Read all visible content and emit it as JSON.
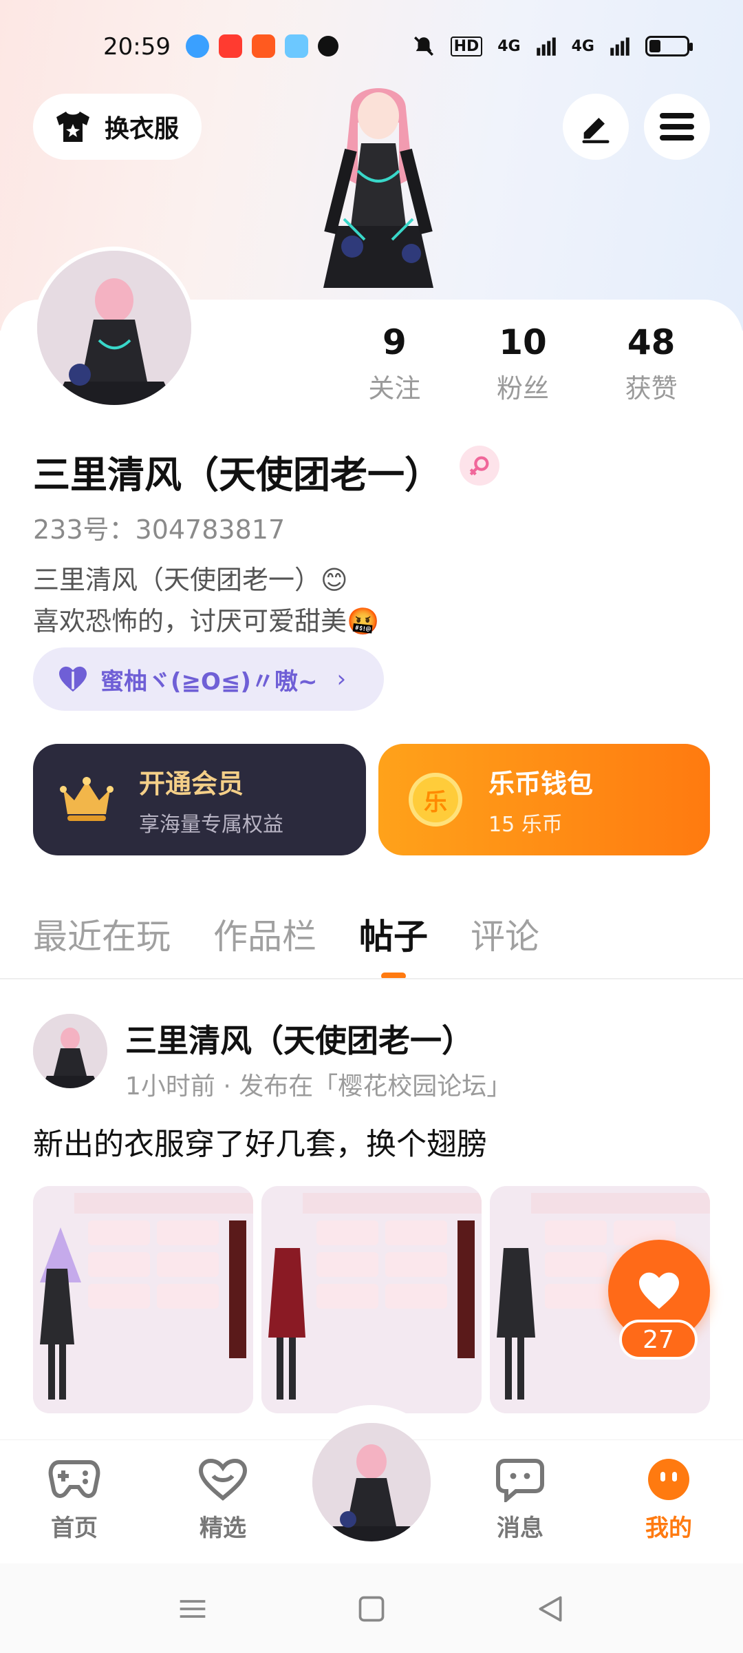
{
  "status_bar": {
    "time": "20:59",
    "hd_label": "HD",
    "signal1": "4G",
    "signal2": "4G",
    "battery_level": 0.3
  },
  "header": {
    "dress_label": "换衣服",
    "edit_icon": "edit-icon",
    "menu_icon": "menu-icon"
  },
  "profile": {
    "stats": [
      {
        "num": "9",
        "label": "关注"
      },
      {
        "num": "10",
        "label": "粉丝"
      },
      {
        "num": "48",
        "label": "获赞"
      }
    ],
    "nickname": "三里清风（天使团老一）",
    "uid": "233号：304783817",
    "bio_line1": "三里清风（天使团老一）😊",
    "bio_line2": "喜欢恐怖的，讨厌可爱甜美🤬",
    "honey_tag": "蜜柚ヾ(≧O≦)〃嗷~",
    "honey_arrow": "›"
  },
  "cards": {
    "vip_title": "开通会员",
    "vip_sub": "享海量专属权益",
    "wallet_title": "乐币钱包",
    "wallet_sub": "15 乐币",
    "coin_glyph": "乐"
  },
  "tabs": [
    {
      "label": "最近在玩"
    },
    {
      "label": "作品栏"
    },
    {
      "label": "帖子"
    },
    {
      "label": "评论"
    }
  ],
  "post": {
    "author": "三里清风（天使团老一）",
    "meta": "1小时前 · 发布在「樱花校园论坛」",
    "text": "新出的衣服穿了好几套，换个翅膀",
    "likes": "27"
  },
  "bottom_nav": [
    {
      "label": "首页"
    },
    {
      "label": "精选"
    },
    {
      "label": "消息"
    },
    {
      "label": "我的"
    }
  ],
  "colors": {
    "accent": "#ff7a10",
    "vip_bg": "#2b2a3d",
    "honey_text": "#6f5fd6"
  }
}
